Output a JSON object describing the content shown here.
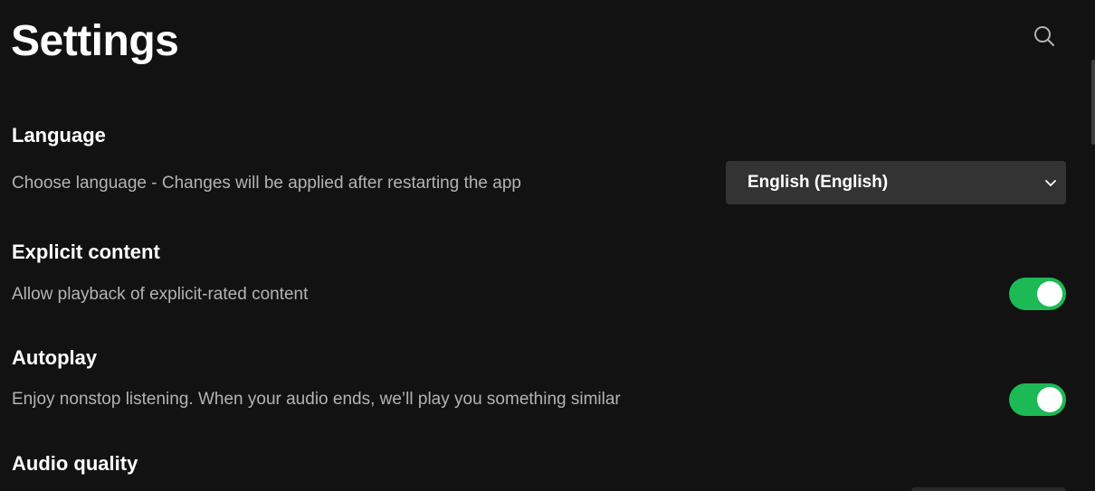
{
  "header": {
    "title": "Settings",
    "search_icon": "search-icon"
  },
  "sections": {
    "language": {
      "heading": "Language",
      "description": "Choose language - Changes will be applied after restarting the app",
      "selected_value": "English (English)",
      "dropdown_icon": "chevron-down-icon"
    },
    "explicit_content": {
      "heading": "Explicit content",
      "description": "Allow playback of explicit-rated content",
      "enabled": true
    },
    "autoplay": {
      "heading": "Autoplay",
      "description": "Enjoy nonstop listening. When your audio ends, we’ll play you something similar",
      "enabled": true
    },
    "audio_quality": {
      "heading": "Audio quality"
    }
  },
  "colors": {
    "background": "#121212",
    "accent_toggle": "#1db954",
    "select_background": "#333333",
    "secondary_text": "#b3b3b3"
  }
}
